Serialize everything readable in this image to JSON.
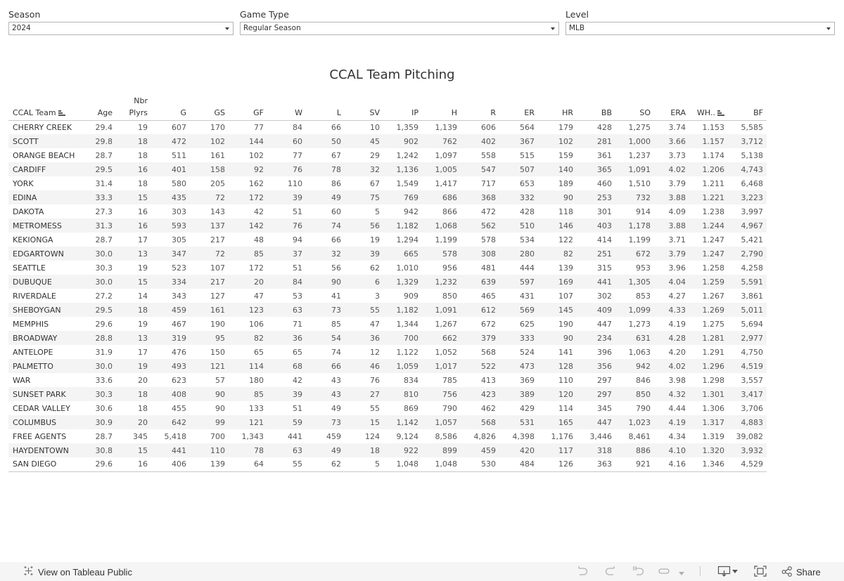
{
  "filters": {
    "season": {
      "label": "Season",
      "value": "2024"
    },
    "game_type": {
      "label": "Game Type",
      "value": "Regular Season"
    },
    "level": {
      "label": "Level",
      "value": "MLB"
    }
  },
  "title": "CCAL Team Pitching",
  "table": {
    "columns": [
      "CCAL Team",
      "Age",
      "Nbr Plyrs",
      "G",
      "GS",
      "GF",
      "W",
      "L",
      "SV",
      "IP",
      "H",
      "R",
      "ER",
      "HR",
      "BB",
      "SO",
      "ERA",
      "WH..",
      "BF"
    ],
    "column_header_lines": {
      "nbr_plyrs_top": "Nbr",
      "nbr_plyrs_bottom": "Plyrs"
    },
    "sorted_columns": [
      "CCAL Team",
      "WH.."
    ],
    "rows": [
      [
        "CHERRY CREEK",
        "29.4",
        "19",
        "607",
        "170",
        "77",
        "84",
        "66",
        "10",
        "1,359",
        "1,139",
        "606",
        "564",
        "179",
        "428",
        "1,275",
        "3.74",
        "1.153",
        "5,585"
      ],
      [
        "SCOTT",
        "29.8",
        "18",
        "472",
        "102",
        "144",
        "60",
        "50",
        "45",
        "902",
        "762",
        "402",
        "367",
        "102",
        "281",
        "1,000",
        "3.66",
        "1.157",
        "3,712"
      ],
      [
        "ORANGE BEACH",
        "28.7",
        "18",
        "511",
        "161",
        "102",
        "77",
        "67",
        "29",
        "1,242",
        "1,097",
        "558",
        "515",
        "159",
        "361",
        "1,237",
        "3.73",
        "1.174",
        "5,138"
      ],
      [
        "CARDIFF",
        "29.5",
        "16",
        "401",
        "158",
        "92",
        "76",
        "78",
        "32",
        "1,136",
        "1,005",
        "547",
        "507",
        "140",
        "365",
        "1,091",
        "4.02",
        "1.206",
        "4,743"
      ],
      [
        "YORK",
        "31.4",
        "18",
        "580",
        "205",
        "162",
        "110",
        "86",
        "67",
        "1,549",
        "1,417",
        "717",
        "653",
        "189",
        "460",
        "1,510",
        "3.79",
        "1.211",
        "6,468"
      ],
      [
        "EDINA",
        "33.3",
        "15",
        "435",
        "72",
        "172",
        "39",
        "49",
        "75",
        "769",
        "686",
        "368",
        "332",
        "90",
        "253",
        "732",
        "3.88",
        "1.221",
        "3,223"
      ],
      [
        "DAKOTA",
        "27.3",
        "16",
        "303",
        "143",
        "42",
        "51",
        "60",
        "5",
        "942",
        "866",
        "472",
        "428",
        "118",
        "301",
        "914",
        "4.09",
        "1.238",
        "3,997"
      ],
      [
        "METROMESS",
        "31.3",
        "16",
        "593",
        "137",
        "142",
        "76",
        "74",
        "56",
        "1,182",
        "1,068",
        "562",
        "510",
        "146",
        "403",
        "1,178",
        "3.88",
        "1.244",
        "4,967"
      ],
      [
        "KEKIONGA",
        "28.7",
        "17",
        "305",
        "217",
        "48",
        "94",
        "66",
        "19",
        "1,294",
        "1,199",
        "578",
        "534",
        "122",
        "414",
        "1,199",
        "3.71",
        "1.247",
        "5,421"
      ],
      [
        "EDGARTOWN",
        "30.0",
        "13",
        "347",
        "72",
        "85",
        "37",
        "32",
        "39",
        "665",
        "578",
        "308",
        "280",
        "82",
        "251",
        "672",
        "3.79",
        "1.247",
        "2,790"
      ],
      [
        "SEATTLE",
        "30.3",
        "19",
        "523",
        "107",
        "172",
        "51",
        "56",
        "62",
        "1,010",
        "956",
        "481",
        "444",
        "139",
        "315",
        "953",
        "3.96",
        "1.258",
        "4,258"
      ],
      [
        "DUBUQUE",
        "30.0",
        "15",
        "334",
        "217",
        "20",
        "84",
        "90",
        "6",
        "1,329",
        "1,232",
        "639",
        "597",
        "169",
        "441",
        "1,305",
        "4.04",
        "1.259",
        "5,591"
      ],
      [
        "RIVERDALE",
        "27.2",
        "14",
        "343",
        "127",
        "47",
        "53",
        "41",
        "3",
        "909",
        "850",
        "465",
        "431",
        "107",
        "302",
        "853",
        "4.27",
        "1.267",
        "3,861"
      ],
      [
        "SHEBOYGAN",
        "29.5",
        "18",
        "459",
        "161",
        "123",
        "63",
        "73",
        "55",
        "1,182",
        "1,091",
        "612",
        "569",
        "145",
        "409",
        "1,099",
        "4.33",
        "1.269",
        "5,011"
      ],
      [
        "MEMPHIS",
        "29.6",
        "19",
        "467",
        "190",
        "106",
        "71",
        "85",
        "47",
        "1,344",
        "1,267",
        "672",
        "625",
        "190",
        "447",
        "1,273",
        "4.19",
        "1.275",
        "5,694"
      ],
      [
        "BROADWAY",
        "28.8",
        "13",
        "319",
        "95",
        "82",
        "36",
        "54",
        "36",
        "700",
        "662",
        "379",
        "333",
        "90",
        "234",
        "631",
        "4.28",
        "1.281",
        "2,977"
      ],
      [
        "ANTELOPE",
        "31.9",
        "17",
        "476",
        "150",
        "65",
        "65",
        "74",
        "12",
        "1,122",
        "1,052",
        "568",
        "524",
        "141",
        "396",
        "1,063",
        "4.20",
        "1.291",
        "4,750"
      ],
      [
        "PALMETTO",
        "30.0",
        "19",
        "493",
        "121",
        "114",
        "68",
        "66",
        "46",
        "1,059",
        "1,017",
        "522",
        "473",
        "128",
        "356",
        "942",
        "4.02",
        "1.296",
        "4,519"
      ],
      [
        "WAR",
        "33.6",
        "20",
        "623",
        "57",
        "180",
        "42",
        "43",
        "76",
        "834",
        "785",
        "413",
        "369",
        "110",
        "297",
        "846",
        "3.98",
        "1.298",
        "3,557"
      ],
      [
        "SUNSET PARK",
        "30.3",
        "18",
        "408",
        "90",
        "85",
        "39",
        "43",
        "27",
        "810",
        "756",
        "423",
        "389",
        "120",
        "297",
        "850",
        "4.32",
        "1.301",
        "3,417"
      ],
      [
        "CEDAR VALLEY",
        "30.6",
        "18",
        "455",
        "90",
        "133",
        "51",
        "49",
        "55",
        "869",
        "790",
        "462",
        "429",
        "114",
        "345",
        "790",
        "4.44",
        "1.306",
        "3,706"
      ],
      [
        "COLUMBUS",
        "30.9",
        "20",
        "642",
        "99",
        "121",
        "59",
        "73",
        "15",
        "1,142",
        "1,057",
        "568",
        "531",
        "165",
        "447",
        "1,023",
        "4.19",
        "1.317",
        "4,883"
      ],
      [
        "FREE AGENTS",
        "28.7",
        "345",
        "5,418",
        "700",
        "1,343",
        "441",
        "459",
        "124",
        "9,124",
        "8,586",
        "4,826",
        "4,398",
        "1,176",
        "3,446",
        "8,461",
        "4.34",
        "1.319",
        "39,082"
      ],
      [
        "HAYDENTOWN",
        "30.8",
        "15",
        "441",
        "110",
        "78",
        "63",
        "49",
        "18",
        "922",
        "899",
        "459",
        "420",
        "117",
        "318",
        "886",
        "4.10",
        "1.320",
        "3,932"
      ],
      [
        "SAN DIEGO",
        "29.6",
        "16",
        "406",
        "139",
        "64",
        "55",
        "62",
        "5",
        "1,048",
        "1,048",
        "530",
        "484",
        "126",
        "363",
        "921",
        "4.16",
        "1.346",
        "4,529"
      ]
    ]
  },
  "footer": {
    "view_on": "View on Tableau Public",
    "share": "Share",
    "icons": [
      "tableau-logo-icon",
      "undo-icon",
      "redo-icon",
      "revert-icon",
      "refresh-icon",
      "pause-dropdown-icon",
      "download-icon",
      "fullscreen-icon",
      "share-icon"
    ]
  }
}
